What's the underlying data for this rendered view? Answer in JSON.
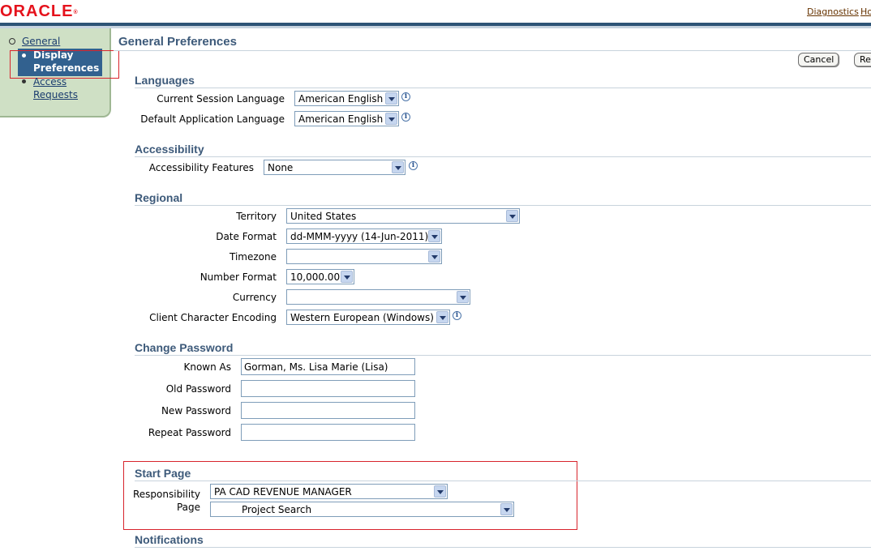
{
  "header": {
    "logo": "ORACLE",
    "links": {
      "diagnostics": "Diagnostics",
      "home": "Ho"
    }
  },
  "sidenav": {
    "items": [
      {
        "label": "General"
      },
      {
        "label_line1": "Display",
        "label_line2": "Preferences"
      },
      {
        "label_line1": "Access",
        "label_line2": "Requests"
      }
    ]
  },
  "page": {
    "title": "General Preferences",
    "buttons": {
      "cancel": "Cancel",
      "apply": "Re"
    }
  },
  "languages": {
    "heading": "Languages",
    "current_session_label": "Current Session Language",
    "current_session_value": "American English",
    "default_app_label": "Default Application Language",
    "default_app_value": "American English"
  },
  "accessibility": {
    "heading": "Accessibility",
    "features_label": "Accessibility Features",
    "features_value": "None"
  },
  "regional": {
    "heading": "Regional",
    "territory_label": "Territory",
    "territory_value": "United States",
    "date_format_label": "Date Format",
    "date_format_value": "dd-MMM-yyyy (14-Jun-2011)",
    "timezone_label": "Timezone",
    "timezone_value": "",
    "number_format_label": "Number Format",
    "number_format_value": "10,000.00",
    "currency_label": "Currency",
    "currency_value": "",
    "encoding_label": "Client Character Encoding",
    "encoding_value": "Western European (Windows)"
  },
  "password": {
    "heading": "Change Password",
    "known_as_label": "Known As",
    "known_as_value": "Gorman, Ms. Lisa Marie (Lisa)",
    "old_label": "Old Password",
    "new_label": "New Password",
    "repeat_label": "Repeat Password"
  },
  "start_page": {
    "heading": "Start Page",
    "responsibility_label": "Responsibility",
    "responsibility_value": "PA CAD REVENUE MANAGER",
    "page_label": "Page",
    "page_value": "Project Search"
  },
  "notifications": {
    "heading": "Notifications"
  },
  "colors": {
    "brand_red": "#e5121c",
    "header_bar": "#2d5476",
    "nav_bg": "#cfe0c5",
    "selected": "#32618f",
    "heading": "#3d5a7a"
  }
}
